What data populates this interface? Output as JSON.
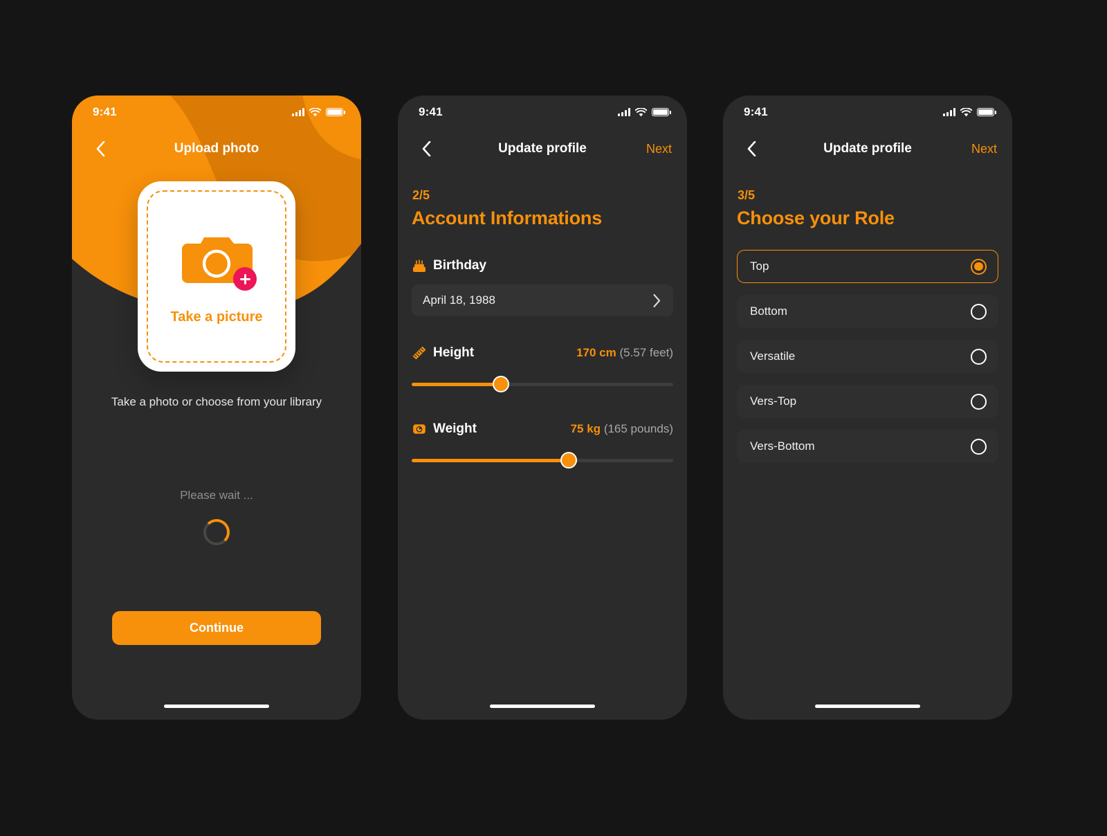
{
  "theme": {
    "accent": "#f7900a",
    "accent_dark": "#d97a06",
    "page_bg": "#151515",
    "phone_bg": "#2b2b2b",
    "card_bg": "#2f2f2f",
    "pink": "#ec1557"
  },
  "status_bar": {
    "time": "9:41"
  },
  "screen1": {
    "nav": {
      "title": "Upload photo",
      "back_icon": "chevron-left-icon"
    },
    "card": {
      "camera_icon": "camera-icon",
      "plus_icon": "plus-icon",
      "cta": "Take a picture"
    },
    "hint": "Take a photo or choose from your library",
    "loading_label": "Please wait ...",
    "spinner_icon": "spinner-icon",
    "continue_label": "Continue"
  },
  "screen2": {
    "nav": {
      "title": "Update profile",
      "next": "Next",
      "back_icon": "chevron-left-icon"
    },
    "step": "2/5",
    "title": "Account Informations",
    "birthday": {
      "icon": "birthday-cake-icon",
      "label": "Birthday",
      "value": "April 18, 1988",
      "chevron_icon": "chevron-right-icon"
    },
    "height": {
      "icon": "ruler-icon",
      "label": "Height",
      "value": "170 cm",
      "secondary": "(5.57 feet)",
      "slider_percent": 34
    },
    "weight": {
      "icon": "scale-icon",
      "label": "Weight",
      "value": "75 kg",
      "secondary": "(165 pounds)",
      "slider_percent": 60
    }
  },
  "screen3": {
    "nav": {
      "title": "Update profile",
      "next": "Next",
      "back_icon": "chevron-left-icon"
    },
    "step": "3/5",
    "title": "Choose your Role",
    "roles": [
      {
        "label": "Top",
        "selected": true
      },
      {
        "label": "Bottom",
        "selected": false
      },
      {
        "label": "Versatile",
        "selected": false
      },
      {
        "label": "Vers-Top",
        "selected": false
      },
      {
        "label": "Vers-Bottom",
        "selected": false
      }
    ]
  }
}
